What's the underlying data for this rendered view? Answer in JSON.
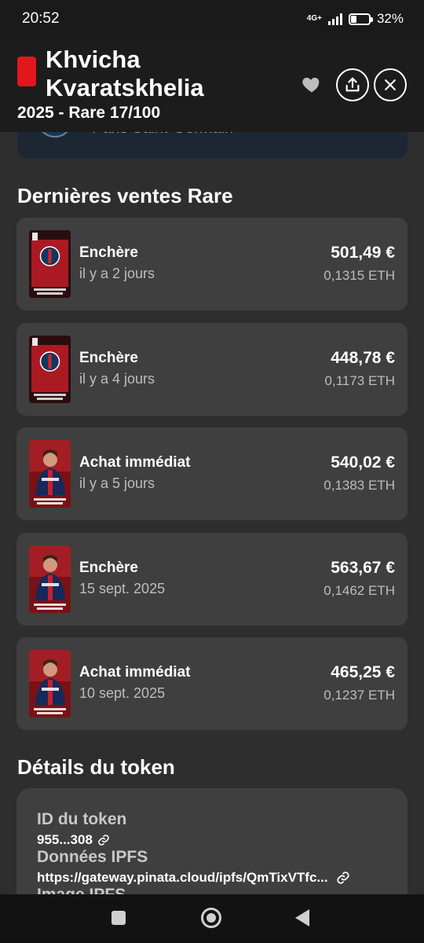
{
  "status": {
    "time": "20:52",
    "network": "4G+",
    "battery_pct": "32%",
    "battery_level": 0.32
  },
  "header": {
    "title": "Khvicha Kvaratskhelia",
    "subtitle": "2025 - Rare 17/100",
    "rarity_color": "#e3151d",
    "icons": [
      "heart-icon",
      "share-icon",
      "close-icon"
    ]
  },
  "club": {
    "name": "Paris Saint-Germain"
  },
  "sales": {
    "title": "Dernières ventes Rare",
    "items": [
      {
        "type": "Enchère",
        "date": "il y a 2 jours",
        "eur": "501,49 €",
        "eth": "0,1315 ETH",
        "thumb_style": "rare-crest"
      },
      {
        "type": "Enchère",
        "date": "il y a 4 jours",
        "eur": "448,78 €",
        "eth": "0,1173 ETH",
        "thumb_style": "rare-crest"
      },
      {
        "type": "Achat immédiat",
        "date": "il y a 5 jours",
        "eur": "540,02 €",
        "eth": "0,1383 ETH",
        "thumb_style": "player-photo"
      },
      {
        "type": "Enchère",
        "date": "15 sept. 2025",
        "eur": "563,67 €",
        "eth": "0,1462 ETH",
        "thumb_style": "player-photo"
      },
      {
        "type": "Achat immédiat",
        "date": "10 sept. 2025",
        "eur": "465,25 €",
        "eth": "0,1237 ETH",
        "thumb_style": "player-photo"
      }
    ]
  },
  "details": {
    "title": "Détails du token",
    "token_id_label": "ID du token",
    "token_id_value": "955...308",
    "ipfs_label": "Données IPFS",
    "ipfs_value": "https://gateway.pinata.cloud/ipfs/QmTixVTfc...",
    "image_label": "Image IPFS"
  },
  "nav": {
    "icons": [
      "recents-icon",
      "home-icon",
      "back-icon"
    ]
  }
}
